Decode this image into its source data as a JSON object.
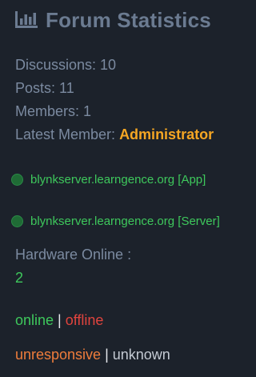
{
  "header": {
    "title": "Forum Statistics",
    "icon": "bar-chart-icon"
  },
  "stats": {
    "discussions": "Discussions: 10",
    "posts": "Posts: 11",
    "members": "Members: 1",
    "latest_member_label": "Latest Member: ",
    "latest_member_name": "Administrator"
  },
  "servers": [
    {
      "label": "blynkserver.learngence.org [App]",
      "status_color": "#1f6b35"
    },
    {
      "label": "blynkserver.learngence.org [Server]",
      "status_color": "#1f6b35"
    }
  ],
  "hardware": {
    "label": "Hardware Online :",
    "count": "2"
  },
  "legend": {
    "separator": " | ",
    "online": "online",
    "offline": "offline",
    "unresponsive": "unresponsive",
    "unknown": "unknown"
  },
  "colors": {
    "background": "#1c222b",
    "title": "#6b7b91",
    "text": "#7b8aa0",
    "accent_admin": "#f5a623",
    "online": "#3ec85c",
    "offline": "#e0443e",
    "unresponsive": "#ef7d3b",
    "unknown": "#c4cad3"
  }
}
